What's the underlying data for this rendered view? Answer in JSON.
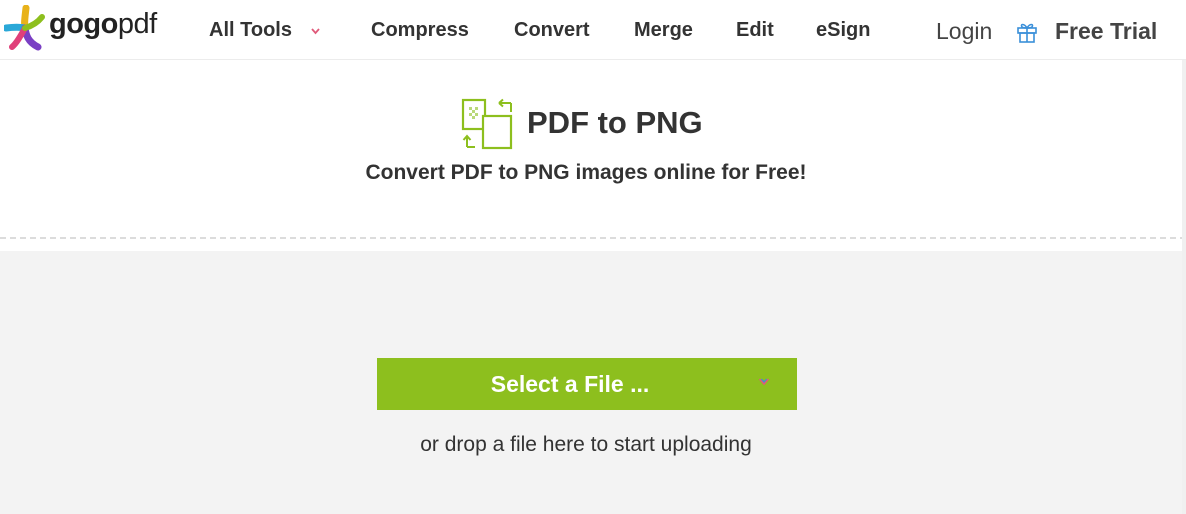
{
  "header": {
    "logo": {
      "bold": "gogo",
      "light": "pdf"
    },
    "nav": [
      {
        "id": "all-tools",
        "label": "All Tools"
      },
      {
        "id": "compress",
        "label": "Compress"
      },
      {
        "id": "convert",
        "label": "Convert"
      },
      {
        "id": "merge",
        "label": "Merge"
      },
      {
        "id": "edit",
        "label": "Edit"
      },
      {
        "id": "esign",
        "label": "eSign"
      }
    ],
    "login_label": "Login",
    "free_trial_label": "Free Trial",
    "icons": {
      "all_tools_caret": "chevron-down-icon",
      "gift": "gift-icon"
    }
  },
  "tool": {
    "icon": "pdf-to-png-icon",
    "title": "PDF to PNG",
    "subtitle": "Convert PDF to PNG images online for Free!"
  },
  "upload": {
    "button_label": "Select a File ...",
    "button_icon": "chevron-down-icon",
    "drop_hint": "or drop a file here to start uploading"
  },
  "colors": {
    "accent_green": "#8dbf1e",
    "nav_caret": "#e05a7a",
    "gift_blue": "#3a8fd9",
    "drop_zone_bg": "#f3f3f3"
  }
}
